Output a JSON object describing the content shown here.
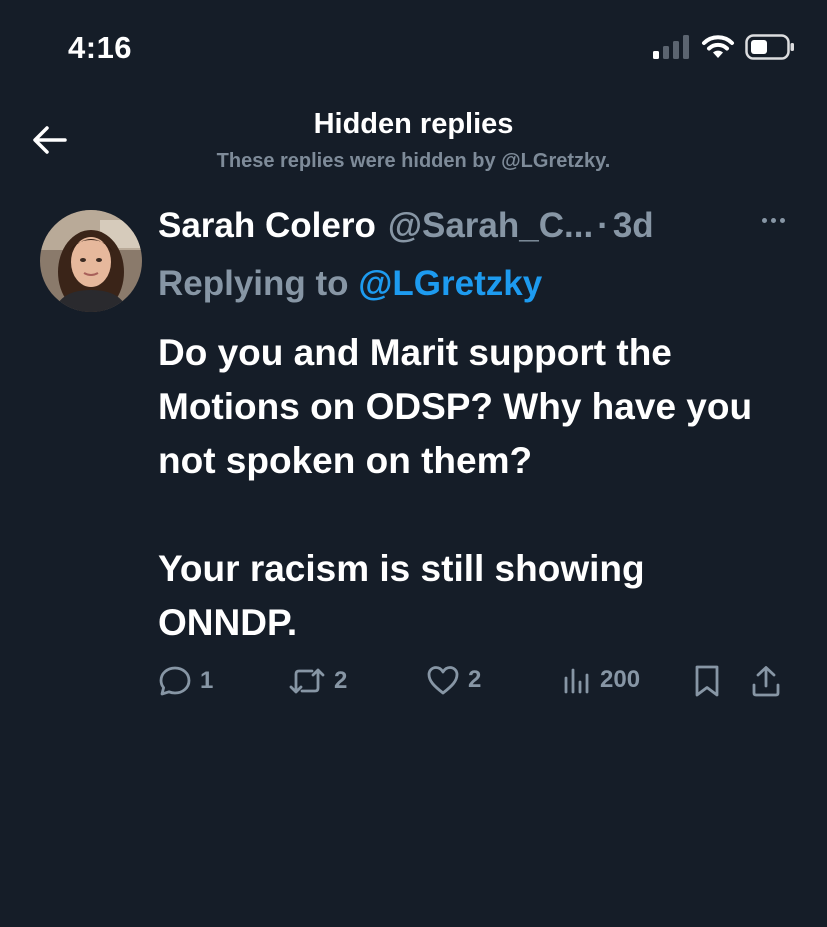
{
  "status_bar": {
    "time": "4:16",
    "icons": [
      "cellular-signal-icon",
      "wifi-icon",
      "battery-icon"
    ]
  },
  "header": {
    "back_icon": "arrow-left-icon",
    "title": "Hidden replies",
    "subtitle": "These replies were hidden by @LGretzky."
  },
  "tweet": {
    "display_name": "Sarah Colero",
    "handle": "@Sarah_C...",
    "separator": "·",
    "time": "3d",
    "replying_prefix": "Replying to",
    "replying_to": "@LGretzky",
    "body_line_1": "Do you and Marit support the Motions on ODSP? Why have you not spoken on them?",
    "body_line_2": "Your racism is still showing ONNDP.",
    "actions": {
      "replies": "1",
      "retweets": "2",
      "likes": "2",
      "views": "200"
    }
  },
  "colors": {
    "background": "#151d28",
    "text_primary": "#ffffff",
    "text_secondary": "#8796a5",
    "link": "#1d9bf0"
  }
}
